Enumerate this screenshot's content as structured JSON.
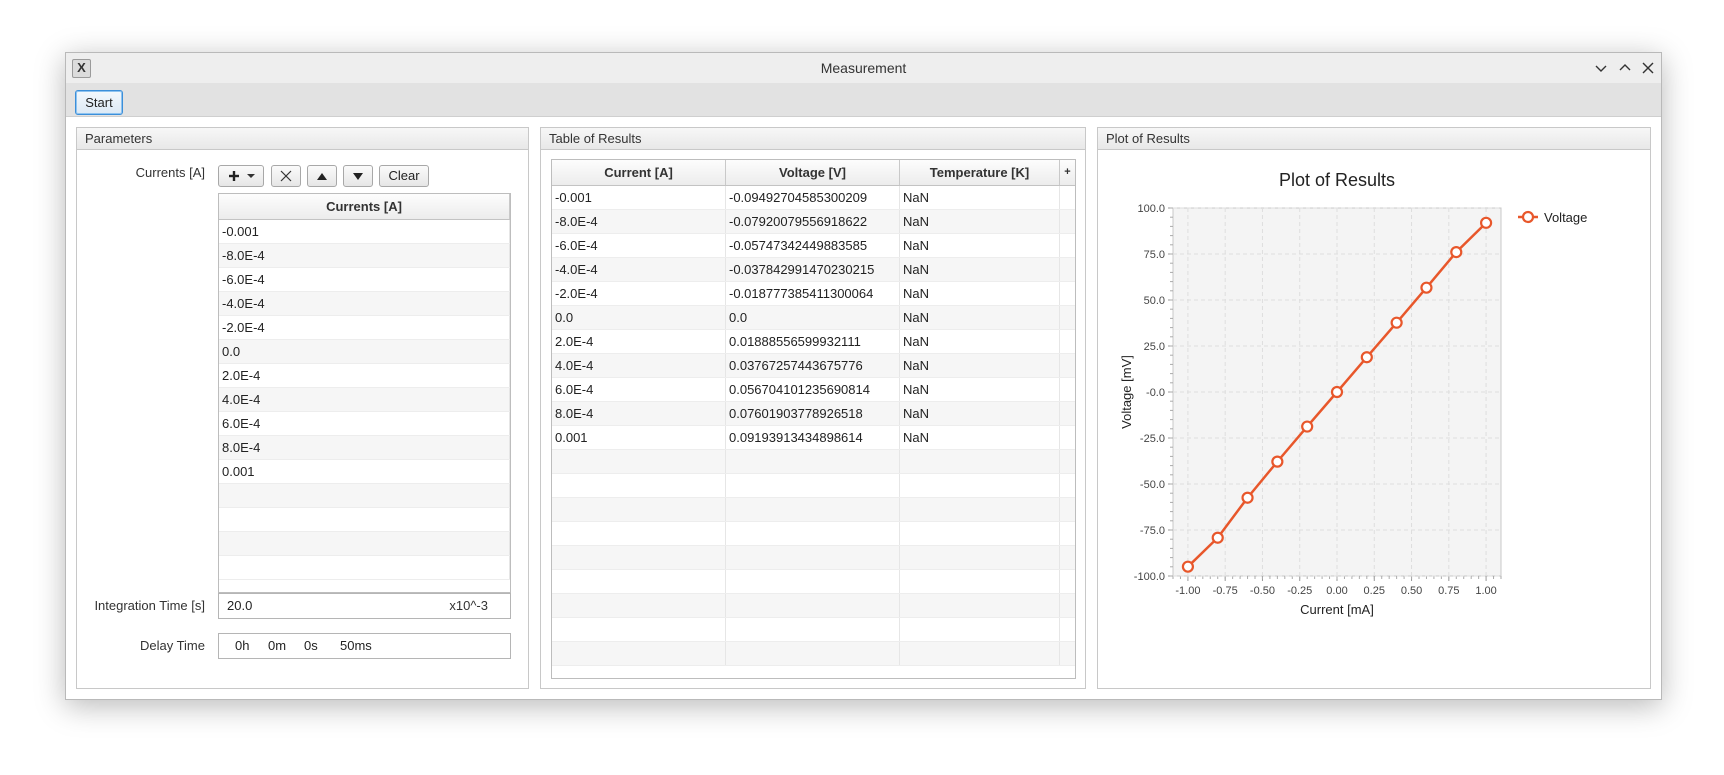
{
  "window": {
    "title": "Measurement",
    "app_icon": "X"
  },
  "toolbar": {
    "start_label": "Start"
  },
  "parameters": {
    "title": "Parameters",
    "currents_label": "Currents [A]",
    "add_icon": "plus-icon",
    "clear_label": "Clear",
    "column_header": "Currents [A]",
    "values": [
      "-0.001",
      "-8.0E-4",
      "-6.0E-4",
      "-4.0E-4",
      "-2.0E-4",
      "0.0",
      "2.0E-4",
      "4.0E-4",
      "6.0E-4",
      "8.0E-4",
      "0.001"
    ],
    "integration_label": "Integration Time [s]",
    "integration_value": "20.0",
    "integration_unit": "x10^-3",
    "delay_label": "Delay Time",
    "delay": {
      "h": "0h",
      "m": "0m",
      "s": "0s",
      "ms": "50ms"
    }
  },
  "results": {
    "title": "Table of Results",
    "columns": [
      "Current [A]",
      "Voltage [V]",
      "Temperature [K]"
    ],
    "rows": [
      [
        "-0.001",
        "-0.09492704585300209",
        "NaN"
      ],
      [
        "-8.0E-4",
        "-0.07920079556918622",
        "NaN"
      ],
      [
        "-6.0E-4",
        "-0.05747342449883585",
        "NaN"
      ],
      [
        "-4.0E-4",
        "-0.037842991470230215",
        "NaN"
      ],
      [
        "-2.0E-4",
        "-0.018777385411300064",
        "NaN"
      ],
      [
        "0.0",
        "0.0",
        "NaN"
      ],
      [
        "2.0E-4",
        "0.01888556599932111",
        "NaN"
      ],
      [
        "4.0E-4",
        "0.03767257443675776",
        "NaN"
      ],
      [
        "6.0E-4",
        "0.056704101235690814",
        "NaN"
      ],
      [
        "8.0E-4",
        "0.07601903778926518",
        "NaN"
      ],
      [
        "0.001",
        "0.09193913434898614",
        "NaN"
      ]
    ]
  },
  "plot": {
    "panel_title": "Plot of Results",
    "accent_color": "#e8572b"
  },
  "chart_data": {
    "type": "line",
    "title": "Plot of Results",
    "xlabel": "Current [mA]",
    "ylabel": "Voltage [mV]",
    "xlim": [
      -1.1,
      1.1
    ],
    "ylim": [
      -100,
      100
    ],
    "x_ticks": [
      "-1.00",
      "-0.75",
      "-0.50",
      "-0.25",
      "0.00",
      "0.25",
      "0.50",
      "0.75",
      "1.00"
    ],
    "y_ticks": [
      "100.0",
      "75.0",
      "50.0",
      "25.0",
      "-0.0",
      "-25.0",
      "-50.0",
      "-75.0",
      "-100.0"
    ],
    "grid": true,
    "legend": "right",
    "series": [
      {
        "name": "Voltage",
        "color": "#e8572b",
        "x": [
          -1.0,
          -0.8,
          -0.6,
          -0.4,
          -0.2,
          0.0,
          0.2,
          0.4,
          0.6,
          0.8,
          1.0
        ],
        "y": [
          -94.93,
          -79.2,
          -57.47,
          -37.84,
          -18.78,
          0.0,
          18.89,
          37.67,
          56.7,
          76.02,
          91.94
        ]
      }
    ]
  }
}
